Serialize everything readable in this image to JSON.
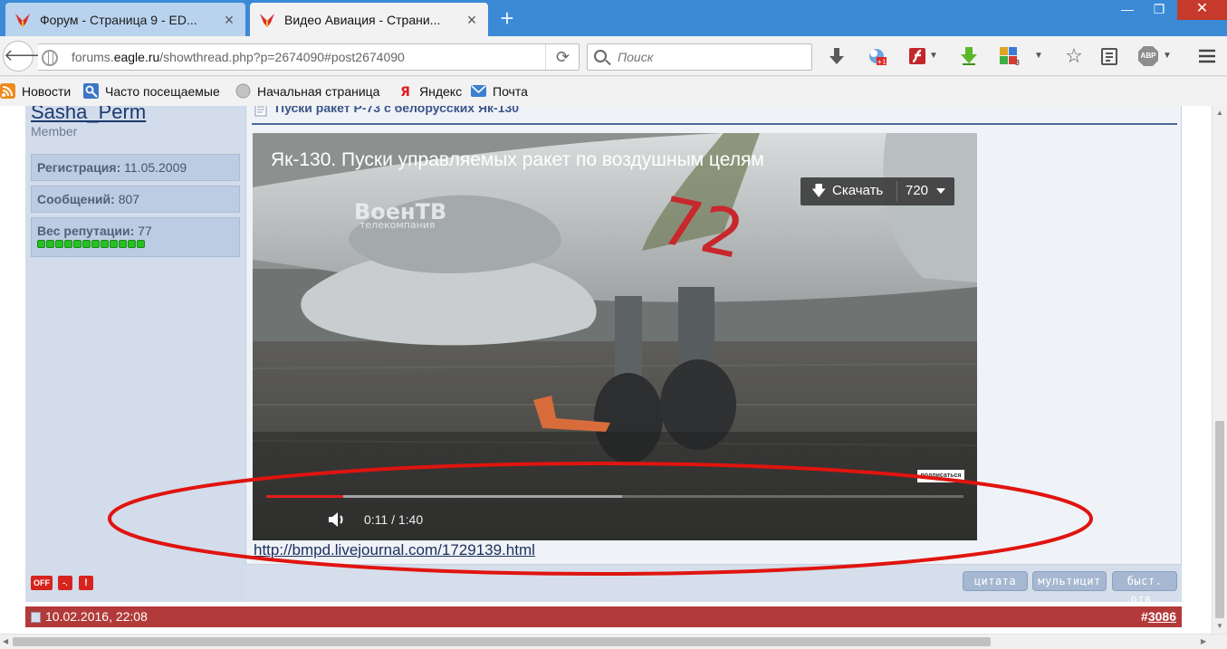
{
  "browser": {
    "tabs": [
      {
        "title": "Форум - Страница 9 - ED...",
        "active": false
      },
      {
        "title": "Видео Авиация - Страни...",
        "active": true
      }
    ],
    "new_tab_label": "+",
    "window_controls": {
      "minimize": "—",
      "maximize": "❐",
      "close": "✕"
    },
    "url_prefix": "forums.",
    "url_domain": "eagle.ru",
    "url_path": "/showthread.php?p=2674090#post2674090",
    "search_placeholder": "Поиск",
    "abp_label": "ABP",
    "bookmarks": [
      "Новости",
      "Часто посещаемые",
      "Начальная страница",
      "Яндекс",
      "Почта"
    ],
    "colors": {
      "tabbar": "#3a8ad6",
      "toolbar": "#f2f2f2"
    }
  },
  "user": {
    "name": "Sasha_Perm",
    "title": "Member",
    "registration_label": "Регистрация:",
    "registration_value": "11.05.2009",
    "posts_label": "Сообщений:",
    "posts_value": "807",
    "reputation_label": "Вес репутации:",
    "reputation_value": "77",
    "reputation_pips": 12,
    "status_icons": [
      "OFF",
      "-.",
      "!"
    ]
  },
  "post": {
    "title": "Пуски ракет Р-73 с белорусских Як-130",
    "link": "http://bmpd.livejournal.com/1729139.html",
    "buttons": [
      "цитата",
      "мультицит",
      "быст. отв."
    ]
  },
  "video": {
    "title": "Як-130. Пуски управляемых ракет по воздушным целям",
    "download_label": "Скачать",
    "quality": "720",
    "watermark_main": "ВоенТВ",
    "watermark_sub": "телекомпания",
    "tail_number": "72",
    "subscribe_label": "подписаться",
    "time": "0:11 / 1:40",
    "played_fraction": 0.11,
    "buffered_fraction": 0.51
  },
  "next_post": {
    "date": "10.02.2016, 22:08",
    "number_prefix": "#",
    "number": "3086"
  },
  "annotation": {
    "color": "#e0140f"
  }
}
